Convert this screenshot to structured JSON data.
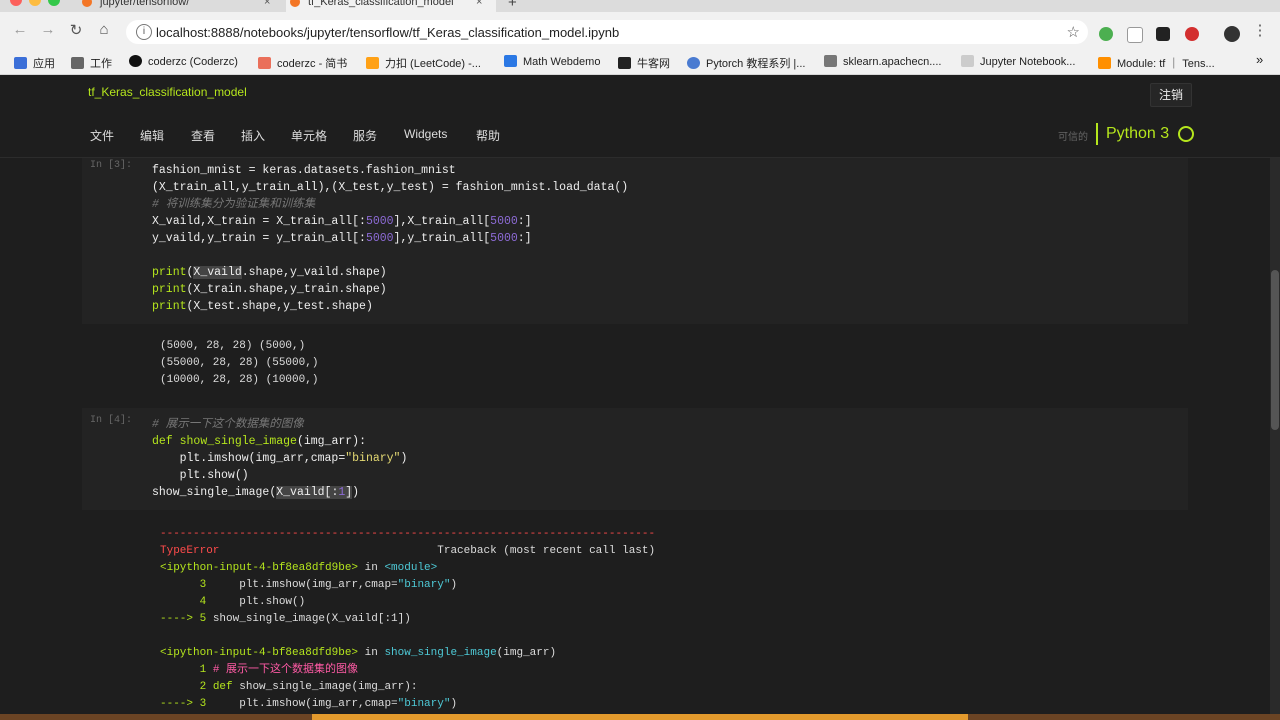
{
  "tabs": [
    {
      "title": "jupyter/tensorflow/",
      "close": "×"
    },
    {
      "title": "tf_Keras_classification_model",
      "close": "×"
    }
  ],
  "new_tab": "+",
  "nav": {
    "back": "←",
    "forward": "→",
    "reload": "↻",
    "home": "⌂",
    "info": "i",
    "url": "localhost:8888/notebooks/jupyter/tensorflow/tf_Keras_classification_model.ipynb",
    "star": "☆"
  },
  "bookmarks": [
    "应用",
    "工作",
    "coderzc (Coderzc)",
    "coderzc - 简书",
    "力扣 (LeetCode) -...",
    "Math Webdemo",
    "牛客网",
    "Pytorch 教程系列 |...",
    "sklearn.apachecn....",
    "Jupyter Notebook...",
    "Module: tf ｜ Tens..."
  ],
  "bookmarks_more": "»",
  "jupyter": {
    "notebook_name": "tf_Keras_classification_model",
    "logout": "注销",
    "menu": [
      "文件",
      "编辑",
      "查看",
      "插入",
      "单元格",
      "服务",
      "Widgets",
      "帮助"
    ],
    "trusted": "可信的",
    "kernel": "Python 3"
  },
  "cells": [
    {
      "prompt": "In [3]:"
    },
    {
      "prompt": "In [4]:"
    }
  ],
  "outputs": {
    "cell3": [
      "(5000, 28, 28) (5000,)",
      "(55000, 28, 28) (55000,)",
      "(10000, 28, 28) (10000,)"
    ]
  },
  "colors": {
    "accent": "#b5e61d",
    "background": "#1e1e1e",
    "error": "#ff4b4b"
  }
}
